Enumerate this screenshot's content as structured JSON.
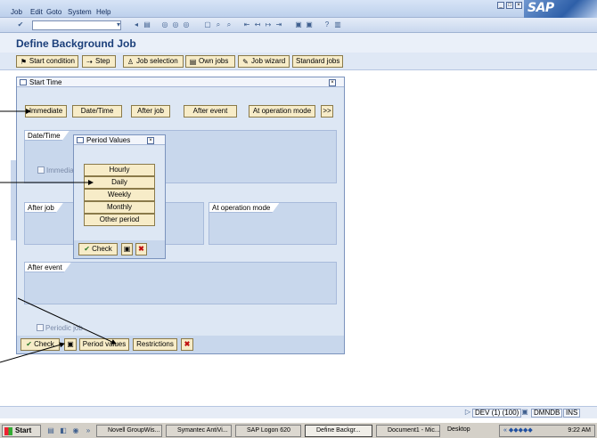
{
  "menu": {
    "items": [
      {
        "label": "Job"
      },
      {
        "label": "Edit"
      },
      {
        "label": "Goto"
      },
      {
        "label": "System"
      },
      {
        "label": "Help"
      }
    ]
  },
  "header": {
    "title": "Define Background Job",
    "logo": "SAP"
  },
  "app_toolbar": {
    "buttons": [
      {
        "label": "Start condition",
        "icon": "flag-icon"
      },
      {
        "label": "Step",
        "icon": "step-icon"
      },
      {
        "label": "Job selection",
        "icon": "person-icon"
      },
      {
        "label": "Own jobs",
        "icon": "document-icon"
      },
      {
        "label": "Job wizard",
        "icon": "wizard-icon"
      },
      {
        "label": "Standard jobs",
        "icon": ""
      }
    ]
  },
  "start_time_dialog": {
    "title": "Start Time",
    "buttons": [
      {
        "label": "Immediate"
      },
      {
        "label": "Date/Time"
      },
      {
        "label": "After job"
      },
      {
        "label": "After event"
      },
      {
        "label": "At operation mode"
      },
      {
        "label": ">>"
      }
    ],
    "groups": {
      "date_time": "Date/Time",
      "immediate_check": "Immediate",
      "after_job": "After job",
      "at_operation_mode": "At operation mode",
      "after_event": "After event",
      "periodic_job": "Periodic job"
    },
    "bottom_buttons": {
      "check": "Check",
      "period_values": "Period values",
      "restrictions": "Restrictions"
    }
  },
  "period_dialog": {
    "title": "Period Values",
    "options": [
      "Hourly",
      "Daily",
      "Weekly",
      "Monthly",
      "Other period"
    ],
    "check": "Check"
  },
  "status_bar": {
    "system": "DEV (1) (100)",
    "server": "DMNDB",
    "mode": "INS"
  },
  "taskbar": {
    "start": "Start",
    "tasks": [
      {
        "label": "Novell GroupWis..."
      },
      {
        "label": "Symantec AntiVi..."
      },
      {
        "label": "SAP Logon 620"
      },
      {
        "label": "Define Backgr...",
        "active": true
      },
      {
        "label": "Document1 - Mic..."
      }
    ],
    "desktop": "Desktop",
    "time": "9:22 AM"
  }
}
